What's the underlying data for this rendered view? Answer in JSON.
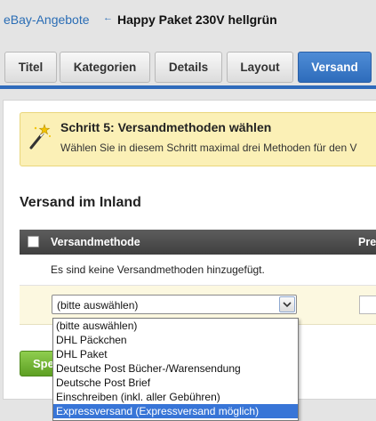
{
  "breadcrumb": {
    "parent_label": "eBay-Angebote",
    "separator": "←",
    "current_title": "Happy Paket 230V hellgrün"
  },
  "tabs": [
    {
      "label": "Titel",
      "active": false
    },
    {
      "label": "Kategorien",
      "active": false
    },
    {
      "label": "Details",
      "active": false
    },
    {
      "label": "Layout",
      "active": false
    },
    {
      "label": "Versand",
      "active": true
    }
  ],
  "notice": {
    "icon": "magic-wand-icon",
    "heading": "Schritt 5: Versandmethoden wählen",
    "text": "Wählen Sie in diesem Schritt maximal drei Methoden für den V"
  },
  "section": {
    "title": "Versand im Inland"
  },
  "table": {
    "columns": [
      "Versandmethode",
      "Pre"
    ],
    "empty_message": "Es sind keine Versandmethoden hinzugefügt.",
    "select_value": "(bitte auswählen)"
  },
  "green_button": {
    "label": "Speichern"
  },
  "dropdown": {
    "options": [
      "(bitte auswählen)",
      "DHL Päckchen",
      "DHL Paket",
      "Deutsche Post Bücher-/Warensendung",
      "Deutsche Post Brief",
      "Einschreiben (inkl. aller Gebühren)",
      "Expressversand (Expressversand möglich)"
    ],
    "highlighted": "Expressversand (Expressversand möglich)"
  },
  "colors": {
    "accent": "#2f6bbb",
    "notice_bg": "#fbf0b6",
    "table_header": "#4a4a4a",
    "highlight": "#3875d7",
    "green": "#6fb52e"
  }
}
